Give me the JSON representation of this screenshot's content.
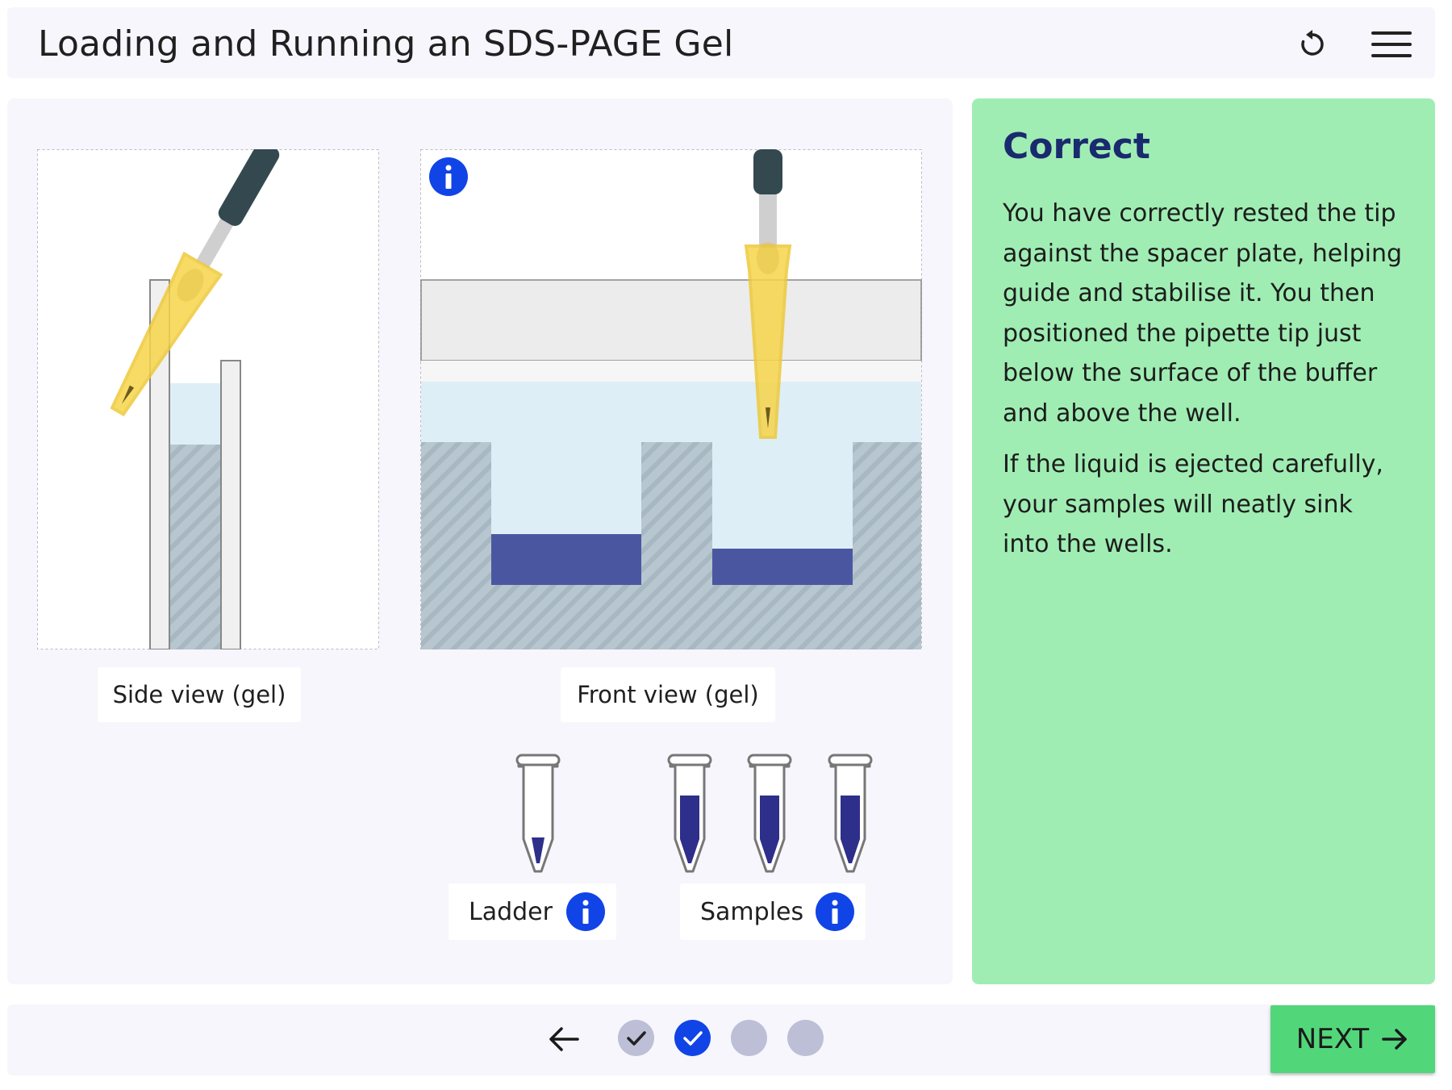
{
  "header": {
    "title": "Loading and Running an SDS-PAGE Gel",
    "reset_icon": "reset-icon",
    "menu_icon": "hamburger-menu-icon"
  },
  "views": {
    "side_label": "Side view (gel)",
    "front_label": "Front view (gel)"
  },
  "tubes": {
    "ladder_label": "Ladder",
    "samples_label": "Samples"
  },
  "feedback": {
    "title": "Correct",
    "paragraph1": "You have correctly rested the tip against the spacer plate, helping guide and stabilise it. You then positioned the pipette tip just below the surface of the buffer and above the well.",
    "paragraph2": "If the liquid is ejected carefully, your samples will neatly sink into the wells."
  },
  "footer": {
    "next_label": "NEXT",
    "progress": [
      "completed",
      "current-completed",
      "pending",
      "pending"
    ]
  },
  "colors": {
    "accent_blue": "#1144e6",
    "feedback_bg": "#a0edb4",
    "next_bg": "#52d67a",
    "sample_dye": "#2e2f8a",
    "pipette_yellow": "#f6d54a"
  }
}
